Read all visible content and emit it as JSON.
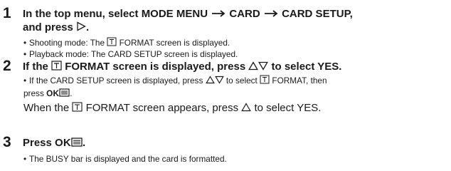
{
  "steps": [
    {
      "number": "1",
      "heading_a": "In the top menu, select MODE MENU",
      "heading_b": "CARD",
      "heading_c": "CARD SETUP,",
      "heading_d": "and press",
      "heading_end": ".",
      "bullets": [
        {
          "lead": "Shooting mode: The",
          "tail": "FORMAT screen is displayed."
        },
        {
          "text": "Playback mode: The CARD SETUP screen is displayed."
        }
      ]
    },
    {
      "number": "2",
      "heading_a": "If the",
      "heading_b": "FORMAT screen is displayed, press",
      "heading_c": "to select YES.",
      "bullet_a": "If the CARD SETUP screen is displayed, press",
      "bullet_b": "to select",
      "bullet_c": "FORMAT, then",
      "bullet_d": "press",
      "bullet_end": ".",
      "note_a": "When the",
      "note_b": "FORMAT screen appears, press",
      "note_c": "to select YES."
    },
    {
      "number": "3",
      "heading": "Press",
      "heading_end": ".",
      "bullet": "The BUSY bar is displayed and the card is formatted."
    }
  ],
  "ok_label": "OK",
  "icons": [
    "arrow-right-icon",
    "triangle-right-icon",
    "card-format-icon",
    "triangle-up-icon",
    "triangle-down-icon",
    "menu-lines-icon"
  ]
}
